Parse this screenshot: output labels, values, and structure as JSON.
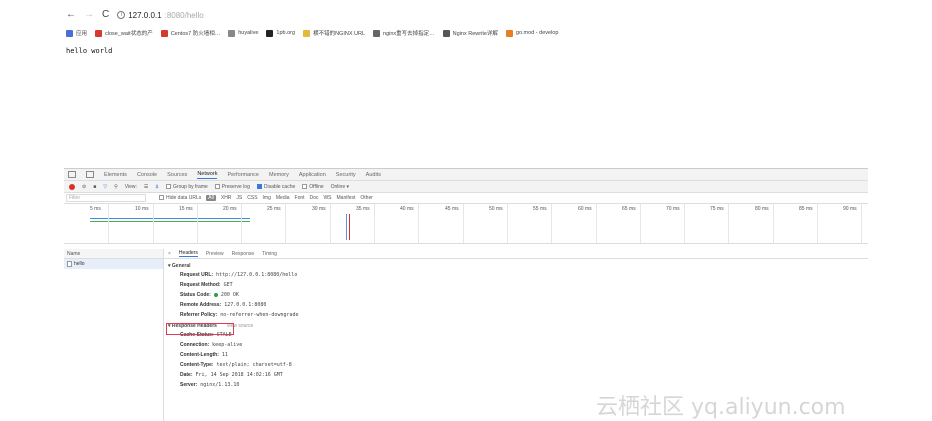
{
  "browser": {
    "url_host": "127.0.0.1",
    "url_path": ":8080/hello",
    "bookmarks": [
      {
        "label": "应用",
        "color": "#4a6fd8"
      },
      {
        "label": "close_wait状态的产",
        "color": "#d33b2f"
      },
      {
        "label": "Centos7 防火墙相…",
        "color": "#d33b2f"
      },
      {
        "label": "huyalive",
        "color": "#888888"
      },
      {
        "label": "1pb.org",
        "color": "#222222"
      },
      {
        "label": "横不错的NGINX URL",
        "color": "#e2b93b"
      },
      {
        "label": "nginx重写去掉指定…",
        "color": "#666666"
      },
      {
        "label": "Nginx Rewrite详解",
        "color": "#555555"
      },
      {
        "label": "go.mod - develop",
        "color": "#e67e22"
      }
    ]
  },
  "page": {
    "body_text": "hello world"
  },
  "devtools": {
    "tabs": [
      "Elements",
      "Console",
      "Sources",
      "Network",
      "Performance",
      "Memory",
      "Application",
      "Security",
      "Audits"
    ],
    "active_tab": "Network",
    "toolbar": {
      "view_label": "View:",
      "group_by_frame": "Group by frame",
      "preserve_log": "Preserve log",
      "disable_cache": "Disable cache",
      "offline": "Offline",
      "online": "Online"
    },
    "filter": {
      "placeholder": "Filter",
      "hide_data_urls": "Hide data URLs",
      "all": "All",
      "types": [
        "XHR",
        "JS",
        "CSS",
        "Img",
        "Media",
        "Font",
        "Doc",
        "WS",
        "Manifest",
        "Other"
      ]
    },
    "timeline_ticks": [
      "5 ms",
      "10 ms",
      "15 ms",
      "20 ms",
      "25 ms",
      "30 ms",
      "35 ms",
      "40 ms",
      "45 ms",
      "50 ms",
      "55 ms",
      "60 ms",
      "65 ms",
      "70 ms",
      "75 ms",
      "80 ms",
      "85 ms",
      "90 ms"
    ],
    "name_header": "Name",
    "requests": [
      "hello"
    ],
    "detail_tabs": [
      "Headers",
      "Preview",
      "Response",
      "Timing"
    ],
    "general": {
      "title": "▾ General",
      "rows": [
        {
          "k": "Request URL:",
          "v": "http://127.0.0.1:8080/hello"
        },
        {
          "k": "Request Method:",
          "v": "GET"
        },
        {
          "k": "Status Code:",
          "v": "200 OK"
        },
        {
          "k": "Remote Address:",
          "v": "127.0.0.1:8080"
        },
        {
          "k": "Referrer Policy:",
          "v": "no-referrer-when-downgrade"
        }
      ]
    },
    "response_headers": {
      "title": "▾ Response Headers",
      "view_source": "view source",
      "rows": [
        {
          "k": "Cache-Status:",
          "v": "STALE"
        },
        {
          "k": "Connection:",
          "v": "keep-alive"
        },
        {
          "k": "Content-Length:",
          "v": "11"
        },
        {
          "k": "Content-Type:",
          "v": "text/plain; charset=utf-8"
        },
        {
          "k": "Date:",
          "v": "Fri, 14 Sep 2018 14:02:16 GMT"
        },
        {
          "k": "Server:",
          "v": "nginx/1.13.10"
        }
      ]
    }
  },
  "watermark": "云栖社区 yq.aliyun.com",
  "colors": {
    "accent": "#3879d9",
    "record": "#d9302c",
    "highlight_box": "#e03c5a",
    "status_ok": "#2e9c48"
  }
}
